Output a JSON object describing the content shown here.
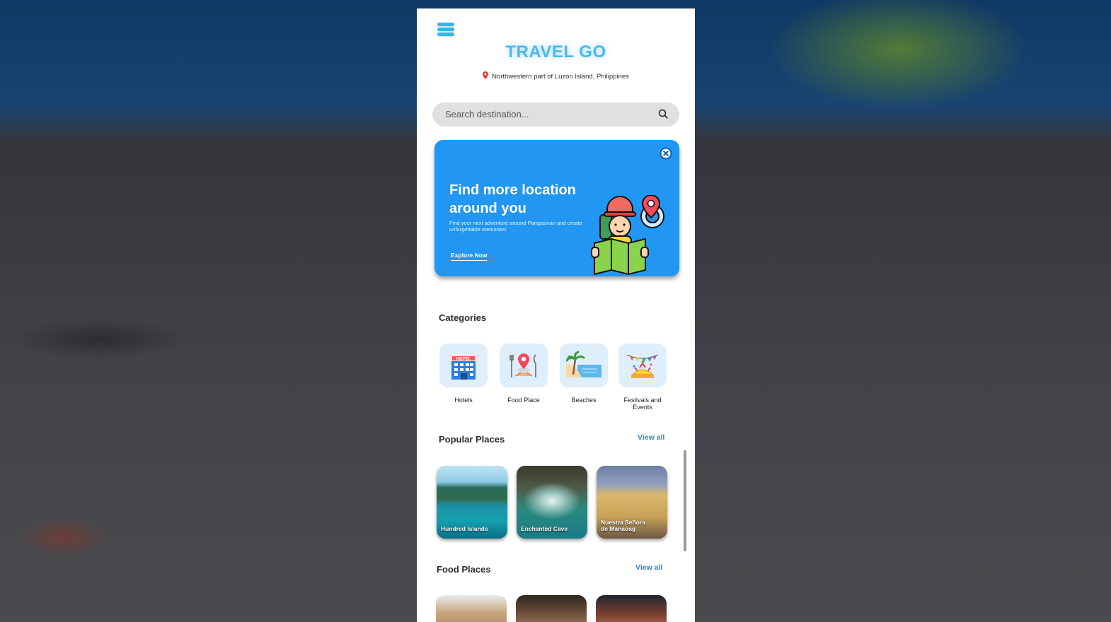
{
  "app": {
    "title": "TRAVEL GO",
    "location": "Northwestern part of Luzon Island, Philippines"
  },
  "search": {
    "placeholder": "Search destination..."
  },
  "banner": {
    "title": "Find more location around you",
    "subtitle": "Find your next adventure around Pangasinan and create unforgettable memories!",
    "cta": "Explore Now"
  },
  "categories": {
    "title": "Categories",
    "items": [
      {
        "label": "Hotels",
        "icon": "hotel-icon"
      },
      {
        "label": "Food Place",
        "icon": "food-place-icon"
      },
      {
        "label": "Beaches",
        "icon": "beach-icon"
      },
      {
        "label": "Festivals and Events",
        "icon": "festival-icon"
      }
    ]
  },
  "popular": {
    "title": "Popular Places",
    "view_all": "View all",
    "items": [
      {
        "label": "Hundred Islands"
      },
      {
        "label": "Enchanted Cave"
      },
      {
        "label": "Nuestra Señora de Manaoag"
      }
    ]
  },
  "food": {
    "title": "Food Places",
    "view_all": "View all"
  },
  "colors": {
    "accent": "#4cb9ee",
    "banner": "#2196f3",
    "link": "#1e88e5"
  }
}
